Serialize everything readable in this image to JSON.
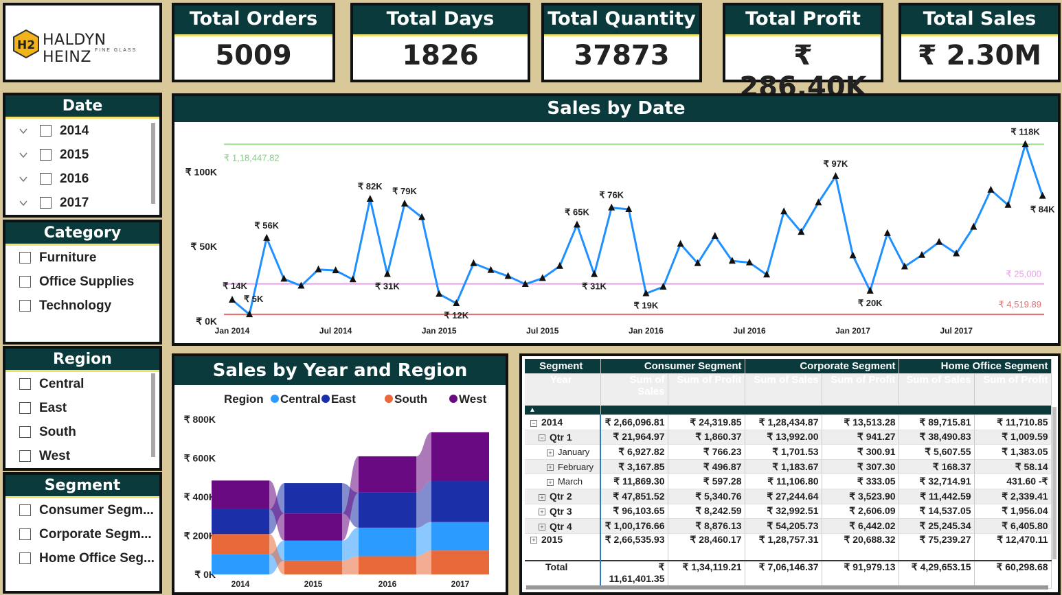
{
  "logo": {
    "mark": "H2",
    "name": "HALDYN HEINZ",
    "sub": "FINE GLASS"
  },
  "kpis": [
    {
      "title": "Total Orders",
      "value": "5009"
    },
    {
      "title": "Total Days",
      "value": "1826"
    },
    {
      "title": "Total Quantity",
      "value": "37873"
    },
    {
      "title": "Total Profit",
      "value": "₹ 286.40K"
    },
    {
      "title": "Total Sales",
      "value": "₹ 2.30M"
    }
  ],
  "slicers": {
    "date": {
      "title": "Date",
      "items": [
        "2014",
        "2015",
        "2016",
        "2017"
      ]
    },
    "category": {
      "title": "Category",
      "items": [
        "Furniture",
        "Office Supplies",
        "Technology"
      ]
    },
    "region": {
      "title": "Region",
      "items": [
        "Central",
        "East",
        "South",
        "West"
      ]
    },
    "segment": {
      "title": "Segment",
      "items": [
        "Consumer Segm...",
        "Corporate Segm...",
        "Home Office Seg..."
      ]
    }
  },
  "colors": {
    "accent": "#0b3a3c",
    "gold": "#f4e36a",
    "line": "#1e90ff",
    "central": "#2b9bff",
    "east": "#1a2fa8",
    "south": "#e8693a",
    "west": "#6a0a82"
  },
  "chart_data": [
    {
      "type": "line",
      "title": "Sales by Date",
      "x_ticks": [
        "Jan 2014",
        "Jul 2014",
        "Jan 2015",
        "Jul 2015",
        "Jan 2016",
        "Jul 2016",
        "Jan 2017",
        "Jul 2017"
      ],
      "y_ticks": [
        "₹ 0K",
        "₹ 50K",
        "₹ 100K"
      ],
      "ylim": [
        0,
        125000
      ],
      "values": [
        14237,
        4520,
        55691,
        28295,
        23648,
        34595,
        33946,
        27909,
        81777,
        31453,
        78629,
        69546,
        18174,
        11951,
        38726,
        34195,
        30132,
        24797,
        28765,
        36898,
        64596,
        31404,
        75972,
        74920,
        18542,
        22979,
        51716,
        38751,
        56988,
        40345,
        39262,
        31115,
        73410,
        59688,
        79412,
        96999,
        43971,
        20301,
        58872,
        36522,
        44261,
        52981,
        45264,
        63121,
        87867,
        77777,
        118448,
        83829
      ],
      "data_labels": [
        {
          "i": 0,
          "text": "₹ 14K"
        },
        {
          "i": 1,
          "text": "₹ 5K"
        },
        {
          "i": 2,
          "text": "₹ 56K"
        },
        {
          "i": 8,
          "text": "₹ 82K"
        },
        {
          "i": 9,
          "text": "₹ 31K"
        },
        {
          "i": 10,
          "text": "₹ 79K"
        },
        {
          "i": 13,
          "text": "₹ 12K"
        },
        {
          "i": 20,
          "text": "₹ 65K"
        },
        {
          "i": 21,
          "text": "₹ 31K"
        },
        {
          "i": 22,
          "text": "₹ 76K"
        },
        {
          "i": 24,
          "text": "₹ 19K"
        },
        {
          "i": 35,
          "text": "₹ 97K"
        },
        {
          "i": 37,
          "text": "₹ 20K"
        },
        {
          "i": 46,
          "text": "₹ 118K"
        },
        {
          "i": 47,
          "text": "₹ 84K"
        }
      ],
      "reference_lines": [
        {
          "value": 118447.82,
          "label": "₹ 1,18,447.82",
          "color": "#9ee08f"
        },
        {
          "value": 25000,
          "label": "₹ 25,000",
          "color": "#e8a0e8"
        },
        {
          "value": 4519.89,
          "label": "₹ 4,519.89",
          "color": "#e07070"
        }
      ]
    },
    {
      "type": "ribbon",
      "title": "Sales by Year and Region",
      "legend_title": "Region",
      "categories": [
        "2014",
        "2015",
        "2016",
        "2017"
      ],
      "y_ticks": [
        "₹ 0K",
        "₹ 200K",
        "₹ 400K",
        "₹ 600K",
        "₹ 800K"
      ],
      "ylim": [
        0,
        800000
      ],
      "series": [
        {
          "name": "Central",
          "values": [
            103839,
            102874,
            147429,
            147098
          ]
        },
        {
          "name": "East",
          "values": [
            128680,
            156332,
            180686,
            213083
          ]
        },
        {
          "name": "South",
          "values": [
            103846,
            71360,
            93610,
            122905
          ]
        },
        {
          "name": "West",
          "values": [
            147883,
            139967,
            187481,
            250129
          ]
        }
      ]
    }
  ],
  "matrix": {
    "header1": [
      "Segment",
      "Consumer Segment",
      "Corporate Segment",
      "Home Office Segment"
    ],
    "header2": [
      "Year",
      "Sum of Sales",
      "Sum of Profit",
      "Sum of Sales",
      "Sum of Profit",
      "Sum of Sales",
      "Sum of Profit"
    ],
    "rows": [
      {
        "label": "2014",
        "level": 0,
        "sign": "−",
        "cells": [
          "₹ 2,66,096.81",
          "₹ 24,319.85",
          "₹ 1,28,434.87",
          "₹ 13,513.28",
          "₹ 89,715.81",
          "₹ 11,710.85"
        ]
      },
      {
        "label": "Qtr 1",
        "level": 1,
        "sign": "−",
        "cells": [
          "₹ 21,964.97",
          "₹ 1,860.37",
          "₹ 13,992.00",
          "₹ 941.27",
          "₹ 38,490.83",
          "₹ 1,009.59"
        ]
      },
      {
        "label": "January",
        "level": 2,
        "sign": "+",
        "cells": [
          "₹ 6,927.82",
          "₹ 766.23",
          "₹ 1,701.53",
          "₹ 300.91",
          "₹ 5,607.55",
          "₹ 1,383.05"
        ]
      },
      {
        "label": "February",
        "level": 2,
        "sign": "+",
        "cells": [
          "₹ 3,167.85",
          "₹ 496.87",
          "₹ 1,183.67",
          "₹ 307.30",
          "₹ 168.37",
          "₹ 58.14"
        ]
      },
      {
        "label": "March",
        "level": 2,
        "sign": "+",
        "cells": [
          "₹ 11,869.30",
          "₹ 597.28",
          "₹ 11,106.80",
          "₹ 333.05",
          "₹ 32,714.91",
          "431.60 -₹"
        ]
      },
      {
        "label": "Qtr 2",
        "level": 1,
        "sign": "+",
        "cells": [
          "₹ 47,851.52",
          "₹ 5,340.76",
          "₹ 27,244.64",
          "₹ 3,523.90",
          "₹ 11,442.59",
          "₹ 2,339.41"
        ]
      },
      {
        "label": "Qtr 3",
        "level": 1,
        "sign": "+",
        "cells": [
          "₹ 96,103.65",
          "₹ 8,242.59",
          "₹ 32,992.51",
          "₹ 2,606.09",
          "₹ 14,537.05",
          "₹ 1,956.04"
        ]
      },
      {
        "label": "Qtr 4",
        "level": 1,
        "sign": "+",
        "cells": [
          "₹ 1,00,176.66",
          "₹ 8,876.13",
          "₹ 54,205.73",
          "₹ 6,442.02",
          "₹ 25,245.34",
          "₹ 6,405.80"
        ]
      },
      {
        "label": "2015",
        "level": 0,
        "sign": "+",
        "cells": [
          "₹ 2,66,535.93",
          "₹ 28,460.17",
          "₹ 1,28,757.31",
          "₹ 20,688.32",
          "₹ 75,239.27",
          "₹ 12,470.11"
        ]
      }
    ],
    "total": {
      "label": "Total",
      "cells": [
        "₹ 11,61,401.35",
        "₹ 1,34,119.21",
        "₹ 7,06,146.37",
        "₹ 91,979.13",
        "₹ 4,29,653.15",
        "₹ 60,298.68"
      ]
    }
  }
}
